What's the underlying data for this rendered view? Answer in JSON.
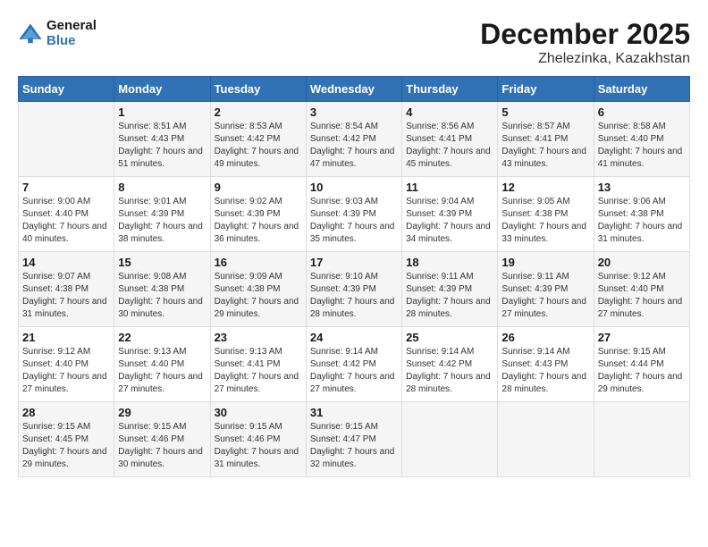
{
  "logo": {
    "line1": "General",
    "line2": "Blue"
  },
  "title": "December 2025",
  "location": "Zhelezinka, Kazakhstan",
  "days_of_week": [
    "Sunday",
    "Monday",
    "Tuesday",
    "Wednesday",
    "Thursday",
    "Friday",
    "Saturday"
  ],
  "weeks": [
    [
      {
        "day": "",
        "sunrise": "",
        "sunset": "",
        "daylight": ""
      },
      {
        "day": "1",
        "sunrise": "Sunrise: 8:51 AM",
        "sunset": "Sunset: 4:43 PM",
        "daylight": "Daylight: 7 hours and 51 minutes."
      },
      {
        "day": "2",
        "sunrise": "Sunrise: 8:53 AM",
        "sunset": "Sunset: 4:42 PM",
        "daylight": "Daylight: 7 hours and 49 minutes."
      },
      {
        "day": "3",
        "sunrise": "Sunrise: 8:54 AM",
        "sunset": "Sunset: 4:42 PM",
        "daylight": "Daylight: 7 hours and 47 minutes."
      },
      {
        "day": "4",
        "sunrise": "Sunrise: 8:56 AM",
        "sunset": "Sunset: 4:41 PM",
        "daylight": "Daylight: 7 hours and 45 minutes."
      },
      {
        "day": "5",
        "sunrise": "Sunrise: 8:57 AM",
        "sunset": "Sunset: 4:41 PM",
        "daylight": "Daylight: 7 hours and 43 minutes."
      },
      {
        "day": "6",
        "sunrise": "Sunrise: 8:58 AM",
        "sunset": "Sunset: 4:40 PM",
        "daylight": "Daylight: 7 hours and 41 minutes."
      }
    ],
    [
      {
        "day": "7",
        "sunrise": "Sunrise: 9:00 AM",
        "sunset": "Sunset: 4:40 PM",
        "daylight": "Daylight: 7 hours and 40 minutes."
      },
      {
        "day": "8",
        "sunrise": "Sunrise: 9:01 AM",
        "sunset": "Sunset: 4:39 PM",
        "daylight": "Daylight: 7 hours and 38 minutes."
      },
      {
        "day": "9",
        "sunrise": "Sunrise: 9:02 AM",
        "sunset": "Sunset: 4:39 PM",
        "daylight": "Daylight: 7 hours and 36 minutes."
      },
      {
        "day": "10",
        "sunrise": "Sunrise: 9:03 AM",
        "sunset": "Sunset: 4:39 PM",
        "daylight": "Daylight: 7 hours and 35 minutes."
      },
      {
        "day": "11",
        "sunrise": "Sunrise: 9:04 AM",
        "sunset": "Sunset: 4:39 PM",
        "daylight": "Daylight: 7 hours and 34 minutes."
      },
      {
        "day": "12",
        "sunrise": "Sunrise: 9:05 AM",
        "sunset": "Sunset: 4:38 PM",
        "daylight": "Daylight: 7 hours and 33 minutes."
      },
      {
        "day": "13",
        "sunrise": "Sunrise: 9:06 AM",
        "sunset": "Sunset: 4:38 PM",
        "daylight": "Daylight: 7 hours and 31 minutes."
      }
    ],
    [
      {
        "day": "14",
        "sunrise": "Sunrise: 9:07 AM",
        "sunset": "Sunset: 4:38 PM",
        "daylight": "Daylight: 7 hours and 31 minutes."
      },
      {
        "day": "15",
        "sunrise": "Sunrise: 9:08 AM",
        "sunset": "Sunset: 4:38 PM",
        "daylight": "Daylight: 7 hours and 30 minutes."
      },
      {
        "day": "16",
        "sunrise": "Sunrise: 9:09 AM",
        "sunset": "Sunset: 4:38 PM",
        "daylight": "Daylight: 7 hours and 29 minutes."
      },
      {
        "day": "17",
        "sunrise": "Sunrise: 9:10 AM",
        "sunset": "Sunset: 4:39 PM",
        "daylight": "Daylight: 7 hours and 28 minutes."
      },
      {
        "day": "18",
        "sunrise": "Sunrise: 9:11 AM",
        "sunset": "Sunset: 4:39 PM",
        "daylight": "Daylight: 7 hours and 28 minutes."
      },
      {
        "day": "19",
        "sunrise": "Sunrise: 9:11 AM",
        "sunset": "Sunset: 4:39 PM",
        "daylight": "Daylight: 7 hours and 27 minutes."
      },
      {
        "day": "20",
        "sunrise": "Sunrise: 9:12 AM",
        "sunset": "Sunset: 4:40 PM",
        "daylight": "Daylight: 7 hours and 27 minutes."
      }
    ],
    [
      {
        "day": "21",
        "sunrise": "Sunrise: 9:12 AM",
        "sunset": "Sunset: 4:40 PM",
        "daylight": "Daylight: 7 hours and 27 minutes."
      },
      {
        "day": "22",
        "sunrise": "Sunrise: 9:13 AM",
        "sunset": "Sunset: 4:40 PM",
        "daylight": "Daylight: 7 hours and 27 minutes."
      },
      {
        "day": "23",
        "sunrise": "Sunrise: 9:13 AM",
        "sunset": "Sunset: 4:41 PM",
        "daylight": "Daylight: 7 hours and 27 minutes."
      },
      {
        "day": "24",
        "sunrise": "Sunrise: 9:14 AM",
        "sunset": "Sunset: 4:42 PM",
        "daylight": "Daylight: 7 hours and 27 minutes."
      },
      {
        "day": "25",
        "sunrise": "Sunrise: 9:14 AM",
        "sunset": "Sunset: 4:42 PM",
        "daylight": "Daylight: 7 hours and 28 minutes."
      },
      {
        "day": "26",
        "sunrise": "Sunrise: 9:14 AM",
        "sunset": "Sunset: 4:43 PM",
        "daylight": "Daylight: 7 hours and 28 minutes."
      },
      {
        "day": "27",
        "sunrise": "Sunrise: 9:15 AM",
        "sunset": "Sunset: 4:44 PM",
        "daylight": "Daylight: 7 hours and 29 minutes."
      }
    ],
    [
      {
        "day": "28",
        "sunrise": "Sunrise: 9:15 AM",
        "sunset": "Sunset: 4:45 PM",
        "daylight": "Daylight: 7 hours and 29 minutes."
      },
      {
        "day": "29",
        "sunrise": "Sunrise: 9:15 AM",
        "sunset": "Sunset: 4:46 PM",
        "daylight": "Daylight: 7 hours and 30 minutes."
      },
      {
        "day": "30",
        "sunrise": "Sunrise: 9:15 AM",
        "sunset": "Sunset: 4:46 PM",
        "daylight": "Daylight: 7 hours and 31 minutes."
      },
      {
        "day": "31",
        "sunrise": "Sunrise: 9:15 AM",
        "sunset": "Sunset: 4:47 PM",
        "daylight": "Daylight: 7 hours and 32 minutes."
      },
      {
        "day": "",
        "sunrise": "",
        "sunset": "",
        "daylight": ""
      },
      {
        "day": "",
        "sunrise": "",
        "sunset": "",
        "daylight": ""
      },
      {
        "day": "",
        "sunrise": "",
        "sunset": "",
        "daylight": ""
      }
    ]
  ]
}
